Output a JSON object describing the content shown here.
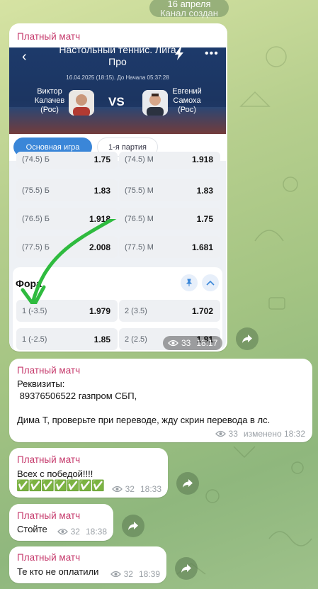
{
  "date_pill": {
    "date": "16 апреля",
    "service": "Канал создан"
  },
  "messages": [
    {
      "sender": "Платный матч",
      "embed": {
        "title": "Настольный теннис. Лига Про",
        "datetime": "16.04.2025 (18:15). До Начала 05:37:28",
        "player1": "Виктор Калачев (Рос)",
        "player1_lines": [
          "Виктор",
          "Калачев",
          "(Рос)"
        ],
        "vs": "VS",
        "player2": "Евгений Самоха (Рос)",
        "player2_lines": [
          "Евгений",
          "Самоха",
          "(Рос)"
        ],
        "tabs": [
          "Основная игра",
          "1-я партия"
        ],
        "total_rows": [
          {
            "l_label": "(74.5) Б",
            "l_val": "1.75",
            "r_label": "(74.5) М",
            "r_val": "1.918"
          },
          {
            "l_label": "(75.5) Б",
            "l_val": "1.83",
            "r_label": "(75.5) М",
            "r_val": "1.83"
          },
          {
            "l_label": "(76.5) Б",
            "l_val": "1.918",
            "r_label": "(76.5) М",
            "r_val": "1.75"
          },
          {
            "l_label": "(77.5) Б",
            "l_val": "2.008",
            "r_label": "(77.5) М",
            "r_val": "1.681"
          }
        ],
        "fora_title": "Фора",
        "fora_rows": [
          {
            "l_label": "1 (-3.5)",
            "l_val": "1.979",
            "r_label": "2 (3.5)",
            "r_val": "1.702"
          },
          {
            "l_label": "1 (-2.5)",
            "l_val": "1.85",
            "r_label": "2 (2.5)",
            "r_val": "1.81"
          }
        ]
      },
      "views": "33",
      "time": "18:17"
    },
    {
      "sender": "Платный матч",
      "line1": "Реквизиты:",
      "line2": " 89376506522 газпром СБП,",
      "line3": "Дима Т, проверьте при переводе, жду скрин перевода в лс.",
      "views": "33",
      "time": "изменено 18:32"
    },
    {
      "sender": "Платный матч",
      "line1": "Всех с победой!!!!",
      "emoji": "✅✅✅✅✅✅✅",
      "views": "32",
      "time": "18:33"
    },
    {
      "sender": "Платный матч",
      "line1": "Стойте",
      "views": "32",
      "time": "18:38"
    },
    {
      "sender": "Платный матч",
      "line1": "Те кто не оплатили",
      "views": "32",
      "time": "18:39"
    }
  ]
}
